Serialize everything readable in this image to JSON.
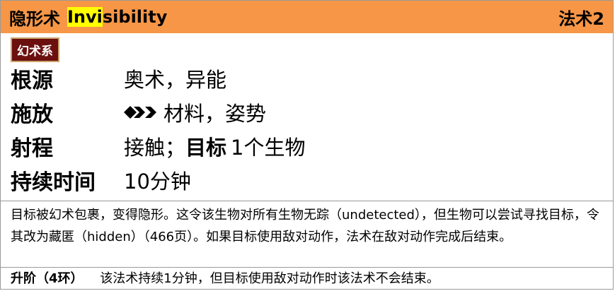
{
  "header": {
    "name_cn": "隐形术",
    "name_en_highlight": "Invi",
    "name_en_rest": "sibility",
    "level": "法术2",
    "header_color": "#f79646",
    "highlight_color": "#ffff00"
  },
  "traits": [
    {
      "label": "幻术系",
      "color": "#6b0f0f"
    }
  ],
  "stats": {
    "tradition": {
      "label": "根源",
      "value": "奥术，异能"
    },
    "cast": {
      "label": "施放",
      "action_icon": "three-actions-icon",
      "value": "材料，姿势"
    },
    "range": {
      "label": "射程",
      "value": "接触；",
      "target_label": "目标",
      "target_value": "1个生物"
    },
    "duration": {
      "label": "持续时间",
      "value": "10分钟"
    }
  },
  "description": "目标被幻术包裹，变得隐形。这令该生物对所有生物无踪（undetected），但生物可以尝试寻找目标，令其改为藏匿（hidden）（466页）。如果目标使用敌对动作，法术在敌对动作完成后结束。",
  "heightened": {
    "label": "升阶（4环）",
    "text": "该法术持续1分钟，但目标使用敌对动作时该法术不会结束。"
  }
}
